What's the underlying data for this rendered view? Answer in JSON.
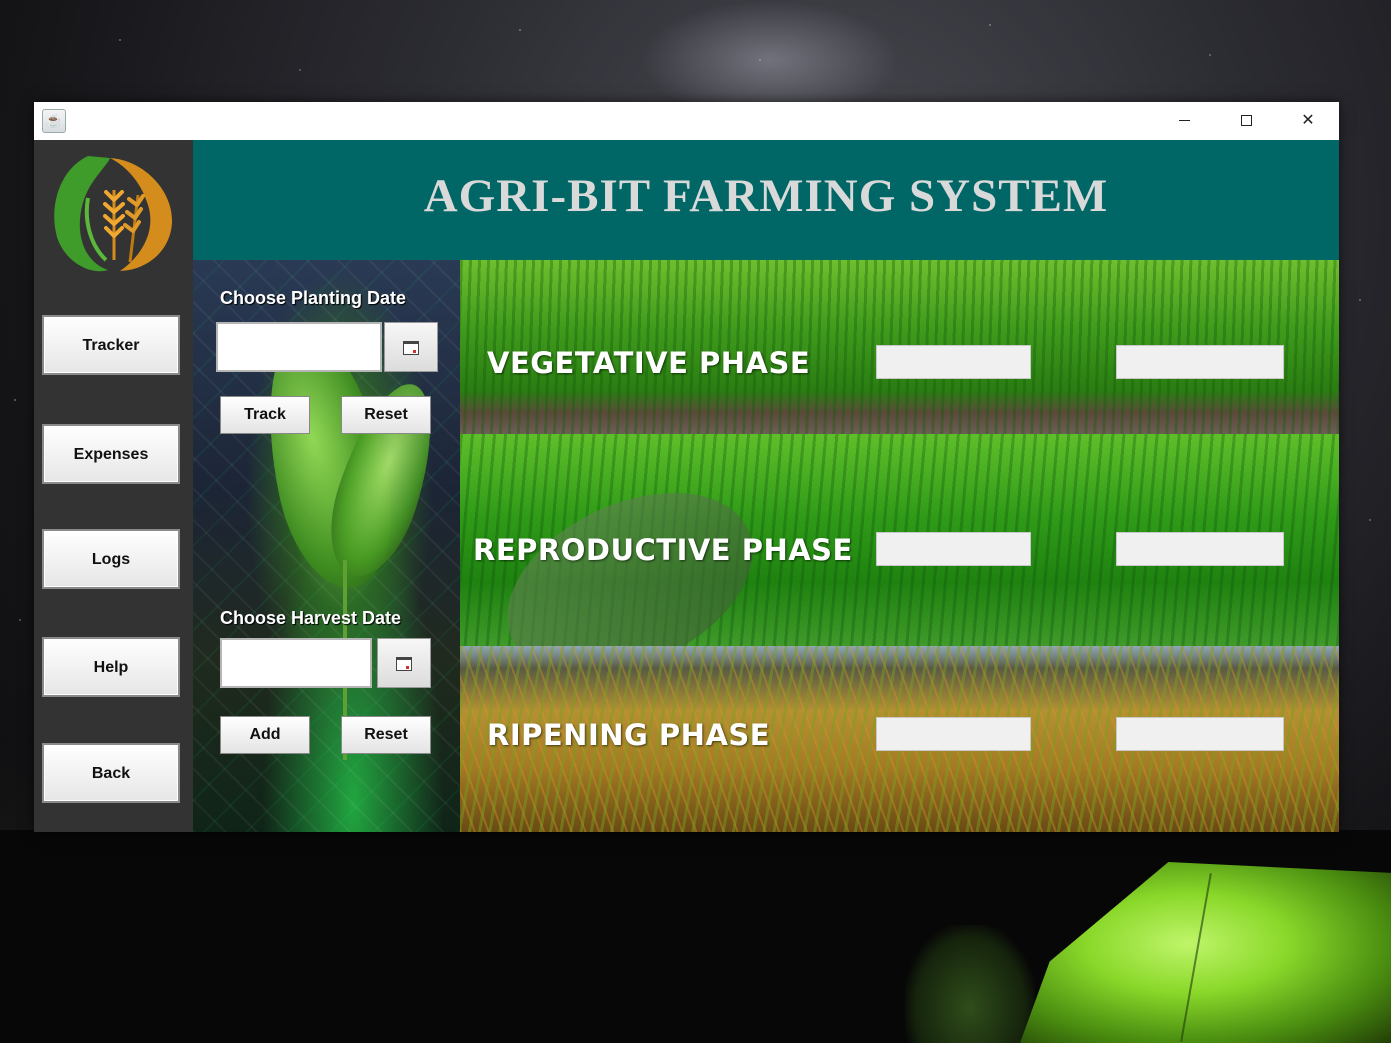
{
  "window": {
    "title": "",
    "controls": {
      "minimize": "minimize-icon",
      "maximize": "maximize-icon",
      "close": "close-icon"
    }
  },
  "header": {
    "title": "AGRI-BIT FARMING SYSTEM"
  },
  "sidebar": {
    "logo": "wheat-leaf-logo",
    "items": [
      {
        "label": "Tracker"
      },
      {
        "label": "Expenses"
      },
      {
        "label": "Logs"
      },
      {
        "label": "Help"
      },
      {
        "label": "Back"
      }
    ]
  },
  "planting": {
    "label": "Choose Planting Date",
    "value": "",
    "calendar_icon": "calendar-icon",
    "track_label": "Track",
    "reset_label": "Reset"
  },
  "harvest": {
    "label": "Choose Harvest Date",
    "value": "",
    "calendar_icon": "calendar-icon",
    "add_label": "Add",
    "reset_label": "Reset"
  },
  "phases": [
    {
      "title": "VEGETATIVE PHASE",
      "start": "",
      "end": ""
    },
    {
      "title": "REPRODUCTIVE PHASE",
      "start": "",
      "end": ""
    },
    {
      "title": "RIPENING PHASE",
      "start": "",
      "end": ""
    }
  ],
  "colors": {
    "header_bg": "#006666",
    "header_text": "#d9d9d9",
    "sidebar_bg": "#333333",
    "button_bg": "#f2f2f2"
  }
}
